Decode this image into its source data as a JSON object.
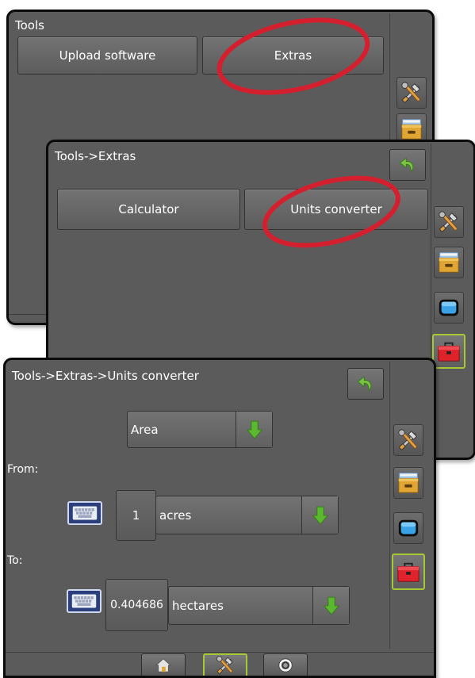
{
  "screen1": {
    "title": "Tools",
    "buttons": {
      "upload_software": "Upload software",
      "extras": "Extras"
    },
    "side_icons": [
      "tools-icon",
      "file-cabinet-icon"
    ]
  },
  "screen2": {
    "title": "Tools->Extras",
    "buttons": {
      "calculator": "Calculator",
      "units_converter": "Units converter"
    },
    "side_icons": [
      "tools-icon",
      "file-cabinet-icon",
      "monitor-icon",
      "toolbox-icon"
    ]
  },
  "screen3": {
    "title": "Tools->Extras->Units converter",
    "category": "Area",
    "from_label": "From:",
    "from_value": "1",
    "from_unit": "acres",
    "to_label": "To:",
    "to_value": "0.404686",
    "to_unit": "hectares",
    "side_icons": [
      "tools-icon",
      "file-cabinet-icon",
      "monitor-icon",
      "toolbox-icon"
    ],
    "bottom_tabs": [
      "home-icon",
      "tools-icon",
      "camera-icon"
    ]
  },
  "colors": {
    "screen_bg": "#5b5b5b",
    "accent_active": "#a6c832",
    "annotation_circle": "#d4202e",
    "arrow_green": "#5cb82e",
    "back_arrow_green": "#7cc242"
  }
}
